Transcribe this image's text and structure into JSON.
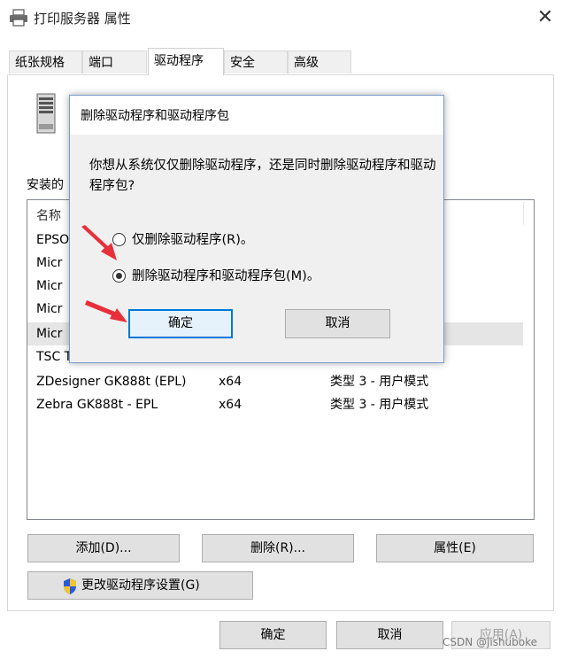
{
  "window": {
    "title": "打印服务器 属性",
    "close_glyph": "✕"
  },
  "tabs": [
    {
      "label": "纸张规格"
    },
    {
      "label": "端口"
    },
    {
      "label": "驱动程序"
    },
    {
      "label": "安全"
    },
    {
      "label": "高级"
    }
  ],
  "panel": {
    "installed_label": "安装的",
    "list_header": {
      "name": "名称"
    },
    "rows": [
      {
        "name": "EPSO",
        "arch": "",
        "type": ""
      },
      {
        "name": "Micr",
        "arch": "",
        "type": ""
      },
      {
        "name": "Micr",
        "arch": "",
        "type": ""
      },
      {
        "name": "Micr",
        "arch": "",
        "type": ""
      },
      {
        "name": "Micr",
        "arch": "",
        "type": ""
      },
      {
        "name": "TSC T",
        "arch": "",
        "type": ""
      },
      {
        "name": "ZDesigner GK888t (EPL)",
        "arch": "x64",
        "type": "类型 3 - 用户模式"
      },
      {
        "name": "Zebra GK888t - EPL",
        "arch": "x64",
        "type": "类型 3 - 用户模式"
      }
    ],
    "buttons": {
      "add": "添加(D)...",
      "remove": "删除(R)...",
      "properties": "属性(E)",
      "change_settings": "更改驱动程序设置(G)"
    }
  },
  "footer": {
    "ok": "确定",
    "cancel": "取消",
    "apply": "应用(A)"
  },
  "modal": {
    "title": "删除驱动程序和驱动程序包",
    "question": "你想从系统仅仅删除驱动程序，还是同时删除驱动程序和驱动程序包?",
    "options": [
      {
        "label": "仅删除驱动程序(R)。",
        "selected": false
      },
      {
        "label": "删除驱动程序和驱动程序包(M)。",
        "selected": true
      }
    ],
    "ok": "确定",
    "cancel": "取消"
  },
  "watermark": "CSDN @jishuboke",
  "colors": {
    "arrow": "#e8303a",
    "accent": "#0078d7"
  }
}
